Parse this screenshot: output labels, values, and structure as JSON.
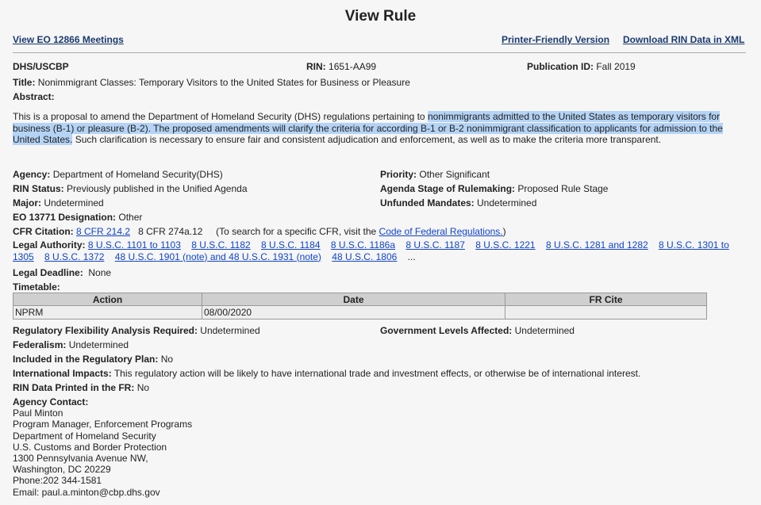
{
  "page_title": "View Rule",
  "links": {
    "meetings": "View EO 12866 Meetings",
    "printer": "Printer-Friendly Version",
    "download": "Download RIN Data in XML"
  },
  "header": {
    "agency_code": "DHS/USCBP",
    "rin_label": "RIN:",
    "rin": "1651-AA99",
    "pub_label": "Publication ID:",
    "pub": "Fall 2019"
  },
  "title": {
    "label": "Title:",
    "value": "Nonimmigrant Classes: Temporary Visitors to the United States for Business or Pleasure"
  },
  "abstract": {
    "label": "Abstract:",
    "part1": "This is a proposal to amend the Department of Homeland Security (DHS) regulations pertaining to ",
    "part2": "nonimmigrants admitted to the United States as temporary visitors for business (B-1) or pleasure (B-2). The proposed amendments will clarify the criteria for according B-1 or B-2 nonimmigrant classification to applicants for admission to the United States.",
    "part3": " Such clarification is necessary to ensure fair and consistent adjudication and enforcement, as well as to make the criteria more transparent."
  },
  "fields": {
    "agency": {
      "label": "Agency:",
      "value": "Department of Homeland Security(DHS)"
    },
    "priority": {
      "label": "Priority:",
      "value": "Other Significant"
    },
    "rin_status": {
      "label": "RIN Status:",
      "value": "Previously published in the Unified Agenda"
    },
    "agenda_stage": {
      "label": "Agenda Stage of Rulemaking:",
      "value": "Proposed Rule Stage"
    },
    "major": {
      "label": "Major:",
      "value": "Undetermined"
    },
    "unfunded": {
      "label": "Unfunded Mandates:",
      "value": "Undetermined"
    },
    "eo": {
      "label": "EO 13771 Designation:",
      "value": "Other"
    },
    "cfr": {
      "label": "CFR Citation:",
      "link1": "8 CFR 214.2",
      "text2": "8 CFR 274a.12",
      "note_pre": "(To search for a specific CFR, visit the ",
      "note_link": "Code of Federal Regulations.",
      "note_post": ")"
    },
    "legal_authority": {
      "label": "Legal Authority:",
      "items": [
        "8 U.S.C. 1101 to 1103",
        "8 U.S.C. 1182",
        "8 U.S.C. 1184",
        "8 U.S.C. 1186a",
        "8 U.S.C. 1187",
        "8 U.S.C. 1221",
        "8 U.S.C. 1281 and 1282",
        "8 U.S.C. 1301 to 1305",
        "8 U.S.C. 1372",
        "48 U.S.C. 1901 (note) and 48 U.S.C. 1931 (note)",
        "48 U.S.C. 1806"
      ],
      "more": "..."
    },
    "deadline": {
      "label": "Legal Deadline:",
      "value": "None"
    },
    "timetable": {
      "label": "Timetable:",
      "headers": [
        "Action",
        "Date",
        "FR Cite"
      ],
      "rows": [
        [
          "NPRM",
          "08/00/2020",
          ""
        ]
      ]
    },
    "rfa": {
      "label": "Regulatory Flexibility Analysis Required:",
      "value": "Undetermined"
    },
    "gov_levels": {
      "label": "Government Levels Affected:",
      "value": "Undetermined"
    },
    "federalism": {
      "label": "Federalism:",
      "value": "Undetermined"
    },
    "reg_plan": {
      "label": "Included in the Regulatory Plan:",
      "value": "No"
    },
    "intl": {
      "label": "International Impacts:",
      "value": "This regulatory action will be likely to have international trade and investment effects, or otherwise be of international interest."
    },
    "rin_fr": {
      "label": "RIN Data Printed in the FR:",
      "value": "No"
    }
  },
  "contact": {
    "label": "Agency Contact:",
    "lines": [
      "Paul Minton",
      "Program Manager, Enforcement Programs",
      "Department of Homeland Security",
      "U.S. Customs and Border Protection",
      "1300 Pennsylvania Avenue NW,",
      "Washington, DC 20229",
      "Phone:202 344-1581",
      "Email: paul.a.minton@cbp.dhs.gov"
    ]
  }
}
